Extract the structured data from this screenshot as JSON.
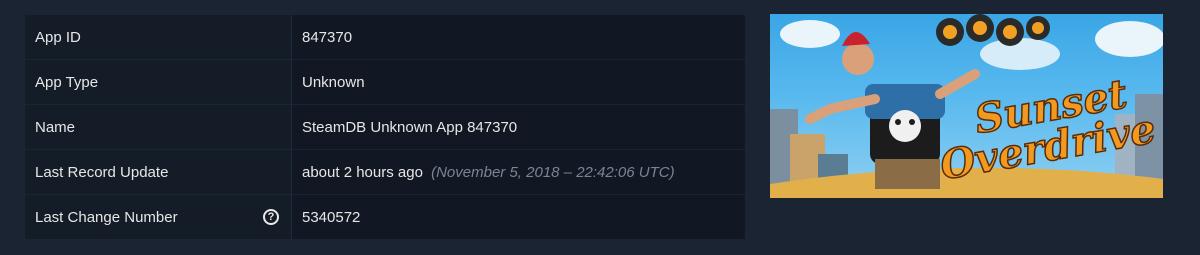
{
  "app_info": {
    "rows": [
      {
        "key": "App ID",
        "value": "847370"
      },
      {
        "key": "App Type",
        "value": "Unknown"
      },
      {
        "key": "Name",
        "value": "SteamDB Unknown App 847370"
      },
      {
        "key": "Last Record Update",
        "value": "about 2 hours ago",
        "detail": "(November 5, 2018 – 22:42:06 UTC)"
      },
      {
        "key": "Last Change Number",
        "value": "5340572"
      }
    ],
    "help_icon_name": "question-circle-icon"
  },
  "header_image": {
    "logo_line1": "Sunset",
    "logo_line2": "Overdrive",
    "logo_color": "#f29a1f",
    "sky_color": "#3aa6e6"
  }
}
